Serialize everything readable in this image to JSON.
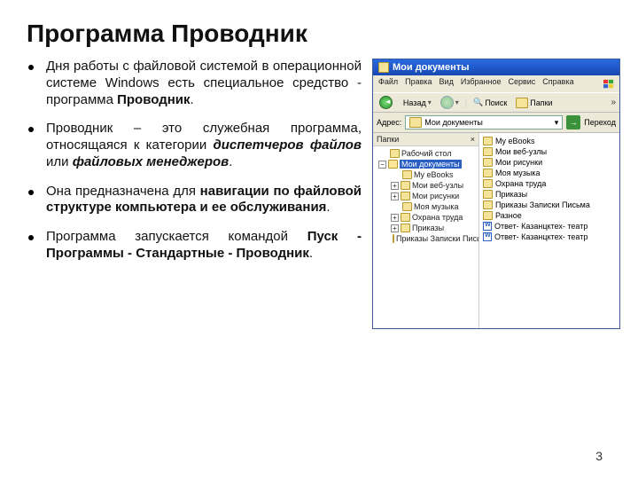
{
  "title": "Программа Проводник",
  "bullets": [
    {
      "pre": "Дня работы с файловой системой в операционной системе Windows есть специальное средство - программа ",
      "b1": "Проводник",
      "post": "."
    },
    {
      "pre": "Проводник – это служебная программа, относящаяся к категории ",
      "i1": "диспетчеров файлов",
      "mid": " или ",
      "i2": "файловых менеджеров",
      "post": "."
    },
    {
      "pre": "Она предназначена для ",
      "b1": "навигации по файловой структуре компьютера и ее обслуживания",
      "post": "."
    },
    {
      "pre": "Программа запускается командой ",
      "b1": "Пуск - Программы - Стандартные - Проводник",
      "post": "."
    }
  ],
  "page_number": "3",
  "explorer": {
    "title": "Мои документы",
    "menu": [
      "Файл",
      "Правка",
      "Вид",
      "Избранное",
      "Сервис",
      "Справка"
    ],
    "toolbar": {
      "back": "Назад",
      "search": "Поиск",
      "folders": "Папки"
    },
    "address_label": "Адрес:",
    "address_value": "Мои документы",
    "go": "Переход",
    "tree_title": "Папки",
    "close": "×",
    "tree": [
      {
        "exp": "",
        "label": "Рабочий стол",
        "cls": ""
      },
      {
        "exp": "−",
        "label": "Мои документы",
        "cls": "sel open"
      },
      {
        "exp": "",
        "label": "My eBooks",
        "cls": "child"
      },
      {
        "exp": "+",
        "label": "Мои веб-узлы",
        "cls": "child"
      },
      {
        "exp": "+",
        "label": "Мои рисунки",
        "cls": "child"
      },
      {
        "exp": "",
        "label": "Моя музыка",
        "cls": "child"
      },
      {
        "exp": "+",
        "label": "Охрана труда",
        "cls": "child"
      },
      {
        "exp": "+",
        "label": "Приказы",
        "cls": "child"
      },
      {
        "exp": "",
        "label": "Приказы Записки Письм",
        "cls": "child"
      }
    ],
    "files": [
      {
        "icon": "dico",
        "label": "My eBooks"
      },
      {
        "icon": "dico",
        "label": "Мои веб-узлы"
      },
      {
        "icon": "dico",
        "label": "Мои рисунки"
      },
      {
        "icon": "dico",
        "label": "Моя музыка"
      },
      {
        "icon": "dico",
        "label": "Охрана труда"
      },
      {
        "icon": "dico",
        "label": "Приказы"
      },
      {
        "icon": "dico",
        "label": "Приказы Записки Письма"
      },
      {
        "icon": "dico",
        "label": "Разное"
      },
      {
        "icon": "wico",
        "label": "Ответ- Казанцктех- театр"
      },
      {
        "icon": "wico",
        "label": "Ответ- Казанцктех- театр"
      }
    ]
  }
}
